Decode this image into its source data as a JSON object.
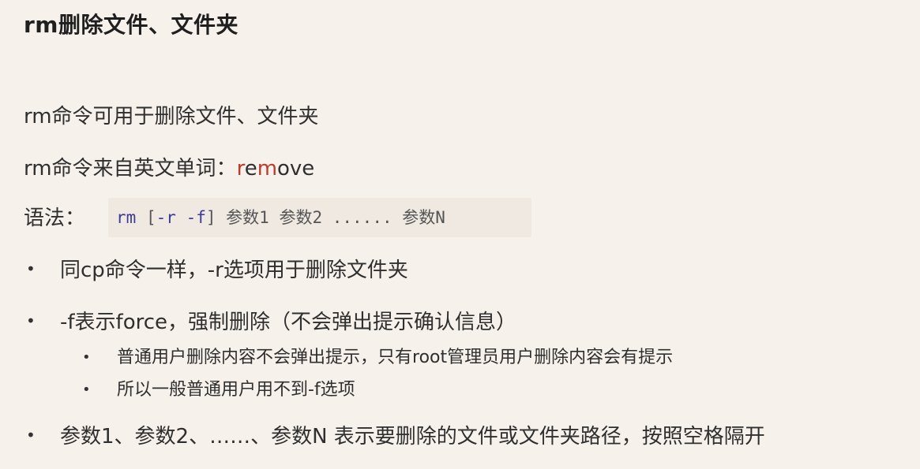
{
  "title": "rm删除文件、文件夹",
  "intro": "rm命令可用于删除文件、文件夹",
  "origin": {
    "prefix": "rm命令来自英文单词：",
    "word_r": "r",
    "word_e": "e",
    "word_m": "m",
    "word_rest": "ove"
  },
  "syntax": {
    "label": "语法：",
    "cmd": "rm",
    "open": "[",
    "opt_r": "-r",
    "opt_f": "-f",
    "close": "]",
    "args": "参数1 参数2 ...... 参数N"
  },
  "bullets": [
    {
      "mark": "•",
      "text": "同cp命令一样，-r选项用于删除文件夹"
    },
    {
      "mark": "•",
      "text": "-f表示force，强制删除（不会弹出提示确认信息）"
    },
    {
      "mark": "•",
      "text": "参数1、参数2、……、参数N 表示要删除的文件或文件夹路径，按照空格隔开"
    }
  ],
  "sub_bullets": [
    {
      "mark": "•",
      "text": "普通用户删除内容不会弹出提示，只有root管理员用户删除内容会有提示"
    },
    {
      "mark": "•",
      "text": "所以一般普通用户用不到-f选项"
    }
  ]
}
